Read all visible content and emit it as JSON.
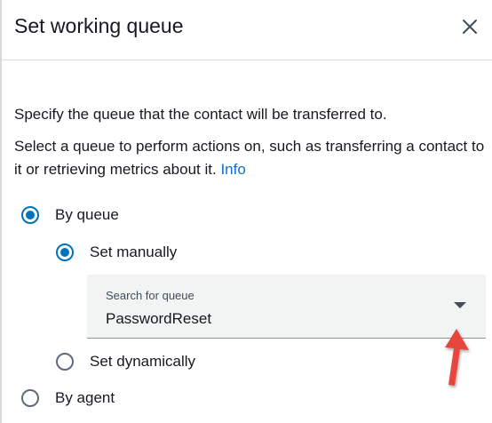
{
  "dialog": {
    "title": "Set working queue",
    "close_icon": "close-icon"
  },
  "content": {
    "description_1": "Specify the queue that the contact will be transferred to.",
    "description_2": "Select a queue to perform actions on, such as transferring a contact to it or retrieving metrics about it.",
    "info_link": "Info"
  },
  "options": {
    "by_queue": {
      "label": "By queue",
      "checked": true
    },
    "set_manually": {
      "label": "Set manually",
      "checked": true
    },
    "set_dynamically": {
      "label": "Set dynamically",
      "checked": false
    },
    "by_agent": {
      "label": "By agent",
      "checked": false
    }
  },
  "queue_select": {
    "label": "Search for queue",
    "value": "PasswordReset",
    "icon": "caret-down-icon"
  },
  "annotation": {
    "icon": "red-arrow-up-icon",
    "color": "#e8453c"
  },
  "colors": {
    "accent": "#0073bb",
    "link": "#0972d3"
  }
}
